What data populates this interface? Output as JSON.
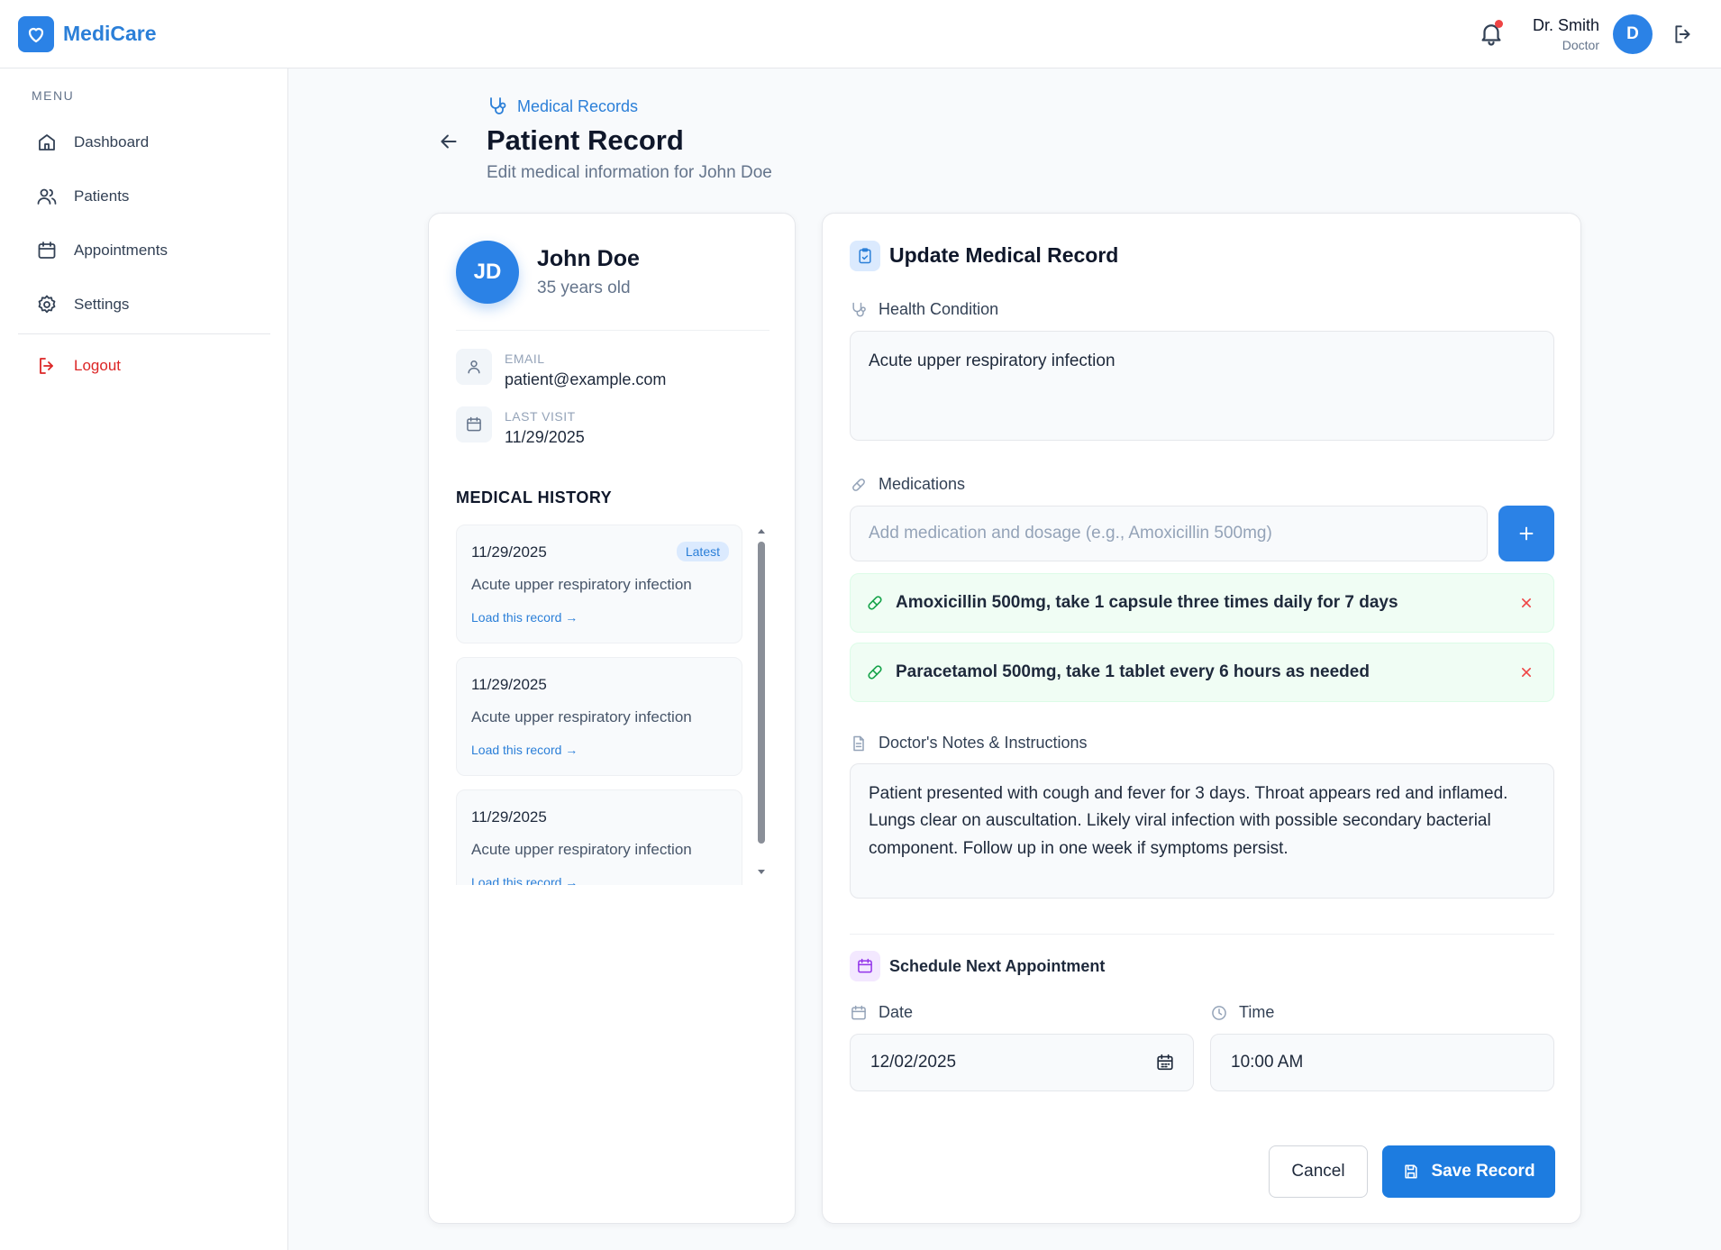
{
  "app": {
    "name": "MediCare"
  },
  "user": {
    "name": "Dr. Smith",
    "role": "Doctor",
    "initial": "D"
  },
  "sidebar": {
    "menu_label": "MENU",
    "items": [
      {
        "label": "Dashboard",
        "icon": "home-icon"
      },
      {
        "label": "Patients",
        "icon": "users-icon"
      },
      {
        "label": "Appointments",
        "icon": "calendar-icon"
      },
      {
        "label": "Settings",
        "icon": "gear-icon"
      }
    ],
    "logout_label": "Logout"
  },
  "header": {
    "breadcrumb": "Medical Records",
    "title": "Patient Record",
    "subtitle": "Edit medical information for John Doe"
  },
  "patient": {
    "initials": "JD",
    "name": "John Doe",
    "age": "35 years old",
    "email_label": "EMAIL",
    "email": "patient@example.com",
    "last_visit_label": "LAST VISIT",
    "last_visit": "11/29/2025"
  },
  "history": {
    "title": "MEDICAL HISTORY",
    "items": [
      {
        "date": "11/29/2025",
        "condition": "Acute upper respiratory infection",
        "link": "Load this record →",
        "badge": "Latest"
      },
      {
        "date": "11/29/2025",
        "condition": "Acute upper respiratory infection",
        "link": "Load this record →"
      },
      {
        "date": "11/29/2025",
        "condition": "Acute upper respiratory infection",
        "link": "Load this record →"
      }
    ]
  },
  "form": {
    "title": "Update Medical Record",
    "health_label": "Health Condition",
    "health_value": "Acute upper respiratory infection",
    "medications_label": "Medications",
    "medication_placeholder": "Add medication and dosage (e.g., Amoxicillin 500mg)",
    "medications": [
      "Amoxicillin 500mg, take 1 capsule three times daily for 7 days",
      "Paracetamol 500mg, take 1 tablet every 6 hours as needed"
    ],
    "notes_label": "Doctor's Notes & Instructions",
    "notes_value": "Patient presented with cough and fever for 3 days. Throat appears red and inflamed. Lungs clear on auscultation. Likely viral infection with possible secondary bacterial component. Follow up in one week if symptoms persist.",
    "schedule_title": "Schedule Next Appointment",
    "date_label": "Date",
    "date_value": "12/02/2025",
    "time_label": "Time",
    "time_value": "10:00 AM",
    "cancel_label": "Cancel",
    "save_label": "Save Record"
  },
  "colors": {
    "primary": "#2b82e6",
    "danger": "#dc2626",
    "success_bg": "#f0fdf4"
  }
}
